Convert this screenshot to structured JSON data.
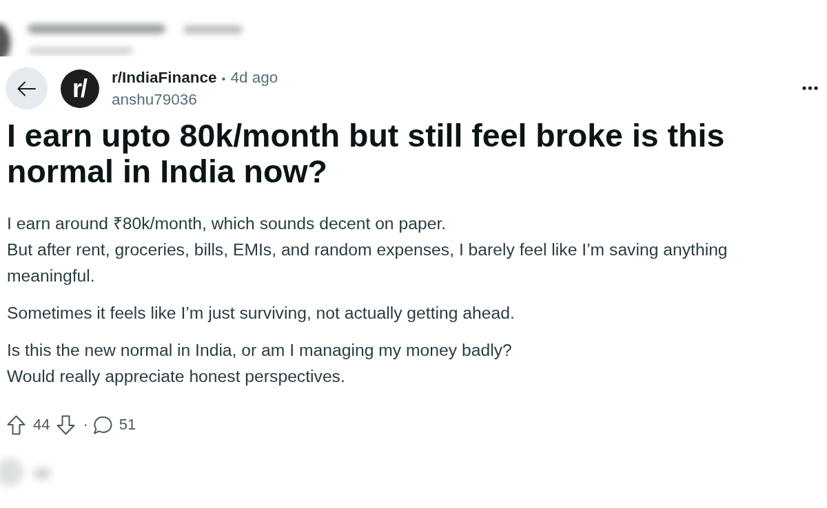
{
  "post": {
    "subreddit": "r/IndiaFinance",
    "avatar_text": "r/",
    "separator": "•",
    "time": "4d ago",
    "author": "anshu79036",
    "title": "I earn upto 80k/month but still feel broke is this normal in India now?",
    "paragraphs": [
      {
        "lines": [
          "I earn around ₹80k/month, which sounds decent on paper.",
          "But after rent, groceries, bills, EMIs, and random expenses, I barely feel like I’m saving anything meaningful."
        ]
      },
      {
        "lines": [
          "Sometimes it feels like I’m just surviving, not actually getting ahead."
        ]
      },
      {
        "lines": [
          "Is this the new normal in India, or am I managing my money badly?",
          "Would really appreciate honest perspectives."
        ]
      }
    ]
  },
  "actions": {
    "score": "44",
    "separator": "·",
    "comments": "51"
  }
}
